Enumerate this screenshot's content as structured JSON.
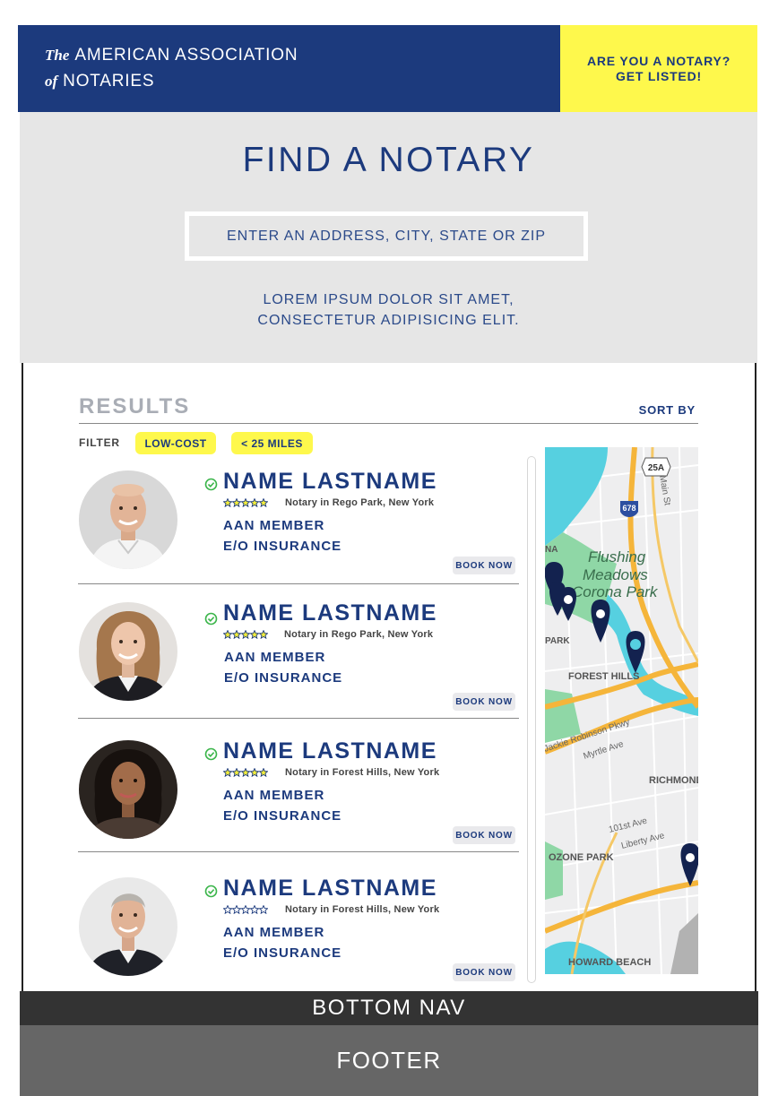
{
  "header": {
    "brand_italic_1": "The",
    "brand_line_1": "AMERICAN ASSOCIATION",
    "brand_italic_2": "of",
    "brand_line_2": "NOTARIES",
    "cta_line_1": "ARE YOU A NOTARY?",
    "cta_line_2": "GET LISTED!"
  },
  "hero": {
    "title": "FIND A NOTARY",
    "search_placeholder": "ENTER AN ADDRESS, CITY, STATE OR ZIP",
    "text_line_1": "LOREM IPSUM DOLOR SIT AMET,",
    "text_line_2": "CONSECTETUR ADIPISICING ELIT."
  },
  "results": {
    "title": "RESULTS",
    "sort_label": "SORT BY",
    "filter_label": "FILTER",
    "filters": [
      "LOW-COST",
      "< 25 MILES"
    ],
    "listings": [
      {
        "name": "NAME LASTNAME",
        "rating": 5,
        "location": "Notary in Rego Park, New York",
        "line1": "AAN MEMBER",
        "line2": "E/O INSURANCE",
        "book": "BOOK NOW"
      },
      {
        "name": "NAME LASTNAME",
        "rating": 5,
        "location": "Notary in Rego Park, New York",
        "line1": "AAN MEMBER",
        "line2": "E/O INSURANCE",
        "book": "BOOK NOW"
      },
      {
        "name": "NAME LASTNAME",
        "rating": 5,
        "location": "Notary in Forest Hills, New York",
        "line1": "AAN MEMBER",
        "line2": "E/O INSURANCE",
        "book": "BOOK NOW"
      },
      {
        "name": "NAME LASTNAME",
        "rating": 0,
        "location": "Notary in Forest Hills, New York",
        "line1": "AAN MEMBER",
        "line2": "E/O INSURANCE",
        "book": "BOOK NOW"
      }
    ]
  },
  "map": {
    "labels": [
      "Flushing",
      "Meadows",
      "Corona Park",
      "FOREST HILLS",
      "RICHMOND HILL",
      "OZONE PARK",
      "HOWARD BEACH",
      "Myrtle Ave",
      "101st Ave",
      "Liberty Ave",
      "Main St",
      "Jackie Robinson Pkwy",
      "PARK",
      "NA",
      "25A",
      "678"
    ],
    "pin_color": "#13224f"
  },
  "bottom_nav": {
    "label": "BOTTOM NAV"
  },
  "footer": {
    "label": "FOOTER"
  },
  "colors": {
    "brand_navy": "#1c3a7d",
    "accent_yellow": "#fef84c",
    "hero_gray": "#e6e6e6"
  }
}
